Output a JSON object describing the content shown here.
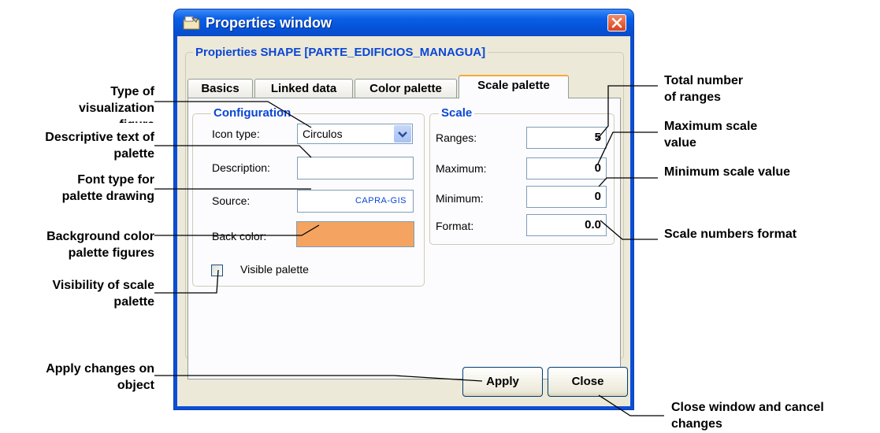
{
  "window": {
    "title": "Properties window",
    "group_title": "Propierties SHAPE [PARTE_EDIFICIOS_MANAGUA]",
    "tabs": [
      {
        "label": "Basics",
        "active": false
      },
      {
        "label": "Linked data",
        "active": false
      },
      {
        "label": "Color palette",
        "active": false
      },
      {
        "label": "Scale palette",
        "active": true
      }
    ],
    "configuration": {
      "title": "Configuration",
      "icon_type_label": "Icon type:",
      "icon_type_value": "Circulos",
      "description_label": "Description:",
      "description_value": "",
      "source_label": "Source:",
      "source_value": "CAPRA-GIS",
      "back_color_label": "Back color:",
      "back_color_value": "#f4a460",
      "visible_label": "Visible palette",
      "visible_checked": false
    },
    "scale": {
      "title": "Scale",
      "ranges_label": "Ranges:",
      "ranges_value": "5",
      "maximum_label": "Maximum:",
      "maximum_value": "0",
      "minimum_label": "Minimum:",
      "minimum_value": "0",
      "format_label": "Format:",
      "format_value": "0.0"
    },
    "apply_label": "Apply",
    "close_label": "Close"
  },
  "annotations": {
    "type_of_visualization": [
      "Type of",
      "visualization",
      "figure"
    ],
    "descriptive_text": [
      "Descriptive text of",
      "palette"
    ],
    "font_type": [
      "Font type for",
      "palette drawing"
    ],
    "background_color": [
      "Background color",
      "palette figures"
    ],
    "visibility": [
      "Visibility of scale",
      "palette"
    ],
    "apply_changes": [
      "Apply changes on",
      "object"
    ],
    "total_ranges": [
      "Total number",
      "of ranges"
    ],
    "maximum_scale": [
      "Maximum scale",
      "value"
    ],
    "minimum_scale": [
      "Minimum scale value"
    ],
    "scale_format": [
      "Scale numbers format"
    ],
    "close_window": [
      "Close window and cancel",
      "changes"
    ]
  },
  "colors": {
    "titlebar": "#0a5fe6",
    "group_title": "#0a46d5",
    "tab_highlight": "#f8a83b",
    "source_text": "#0a46d5"
  }
}
